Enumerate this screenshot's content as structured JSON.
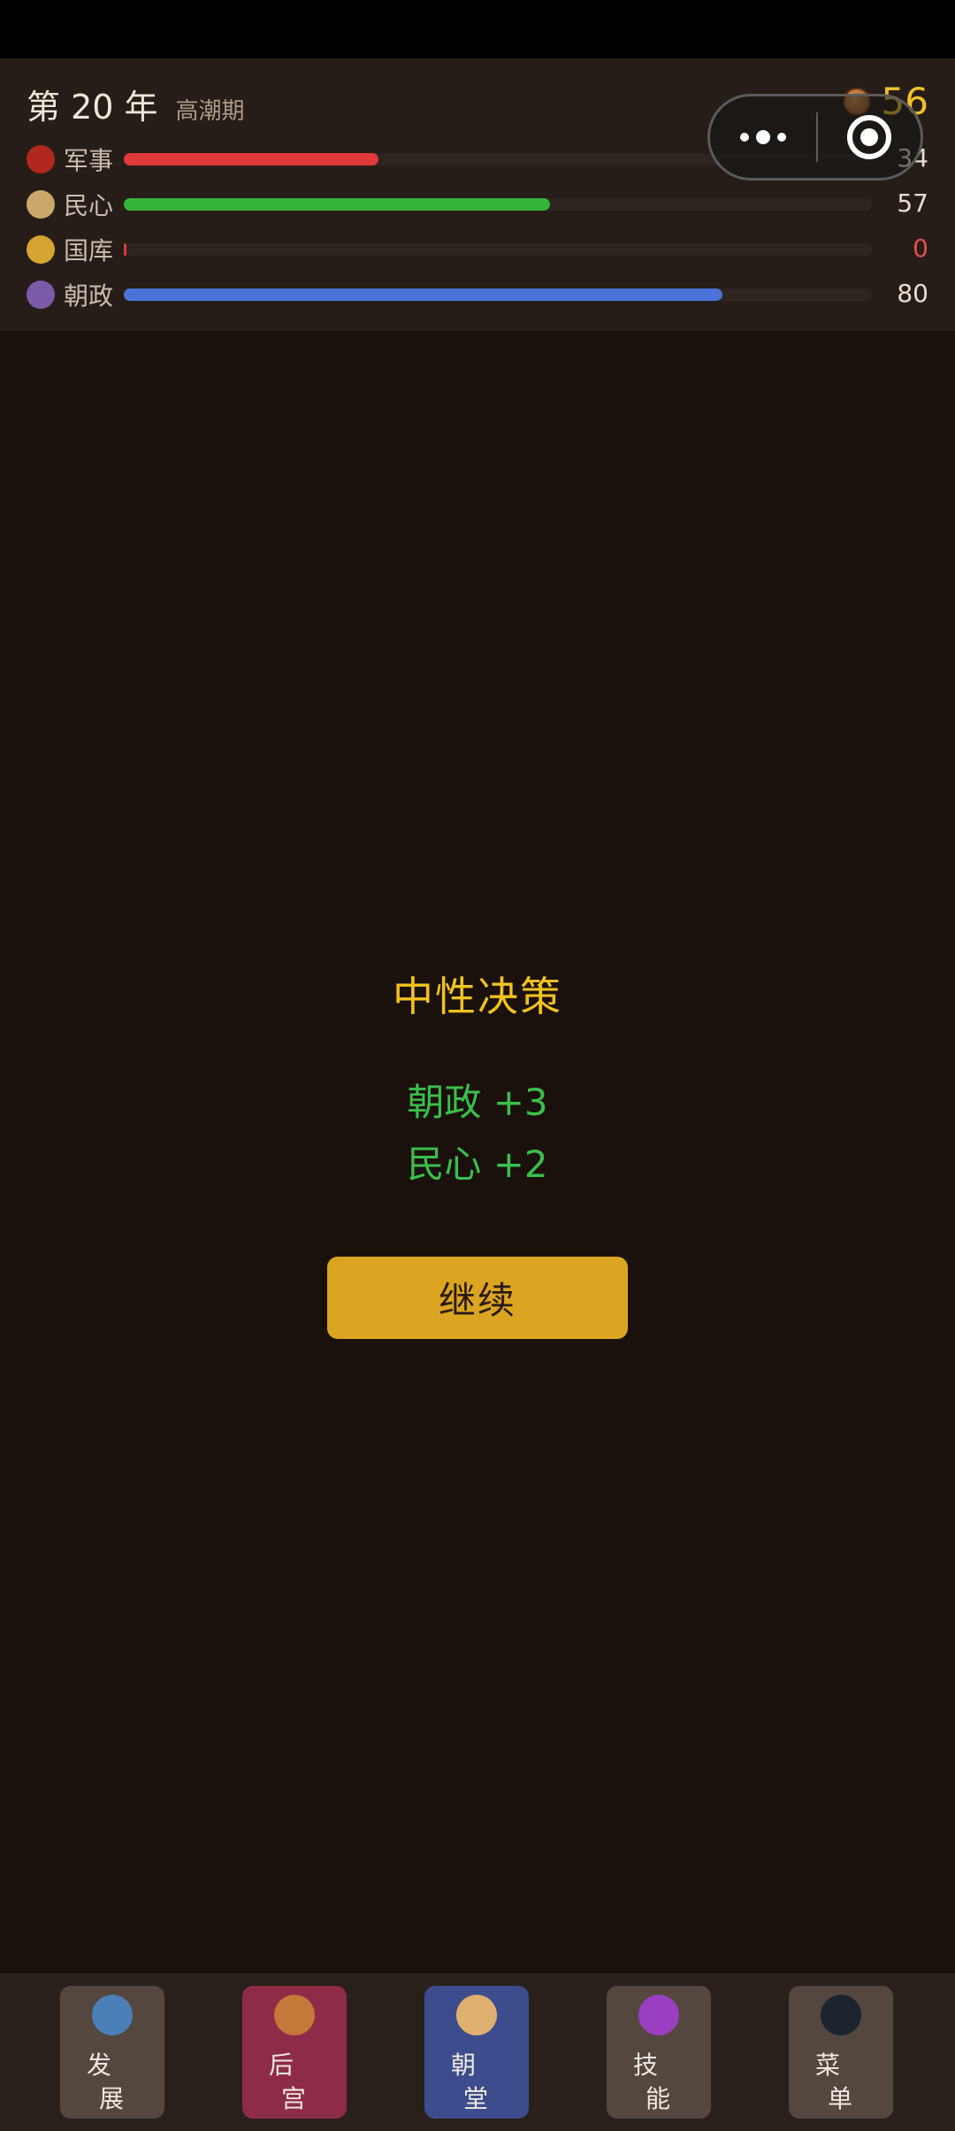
{
  "header": {
    "year_label": "第 20 年",
    "phase": "高潮期",
    "coins": "56"
  },
  "stats": [
    {
      "label": "军事",
      "value": "34",
      "level": 34,
      "color": "#e03a3a",
      "icon": "helmet-icon",
      "icon_color": "#b0281e"
    },
    {
      "label": "民心",
      "value": "57",
      "level": 57,
      "color": "#35b43a",
      "icon": "people-icon",
      "icon_color": "#c9a86a"
    },
    {
      "label": "国库",
      "value": "0",
      "level": 0,
      "color": "#e03a3a",
      "icon": "treasury-icon",
      "icon_color": "#d6a430"
    },
    {
      "label": "朝政",
      "value": "80",
      "level": 80,
      "color": "#4a72d8",
      "icon": "court-icon",
      "icon_color": "#7b5aa8"
    }
  ],
  "result": {
    "title": "中性决策",
    "effect_1": "朝政 +3",
    "effect_2": "民心 +2",
    "continue_label": "继续"
  },
  "nav": [
    {
      "c1": "发",
      "c2": "展",
      "bg": "#54473f",
      "icon": "development-icon",
      "icon_color": "#4b7fb8"
    },
    {
      "c1": "后",
      "c2": "宫",
      "bg": "#8e2c48",
      "icon": "harem-icon",
      "icon_color": "#c4783a"
    },
    {
      "c1": "朝",
      "c2": "堂",
      "bg": "#3c4c8c",
      "icon": "court-hall-icon",
      "icon_color": "#e0b070"
    },
    {
      "c1": "技",
      "c2": "能",
      "bg": "#54473f",
      "icon": "skills-icon",
      "icon_color": "#9a3fc0"
    },
    {
      "c1": "菜",
      "c2": "单",
      "bg": "#54473f",
      "icon": "menu-icon",
      "icon_color": "#1c2430"
    }
  ],
  "colors": {
    "accent_gold": "#f2c21e",
    "effect_green": "#3bbf4a",
    "button_gold": "#dba521",
    "zero_value_red": "#e05050"
  }
}
